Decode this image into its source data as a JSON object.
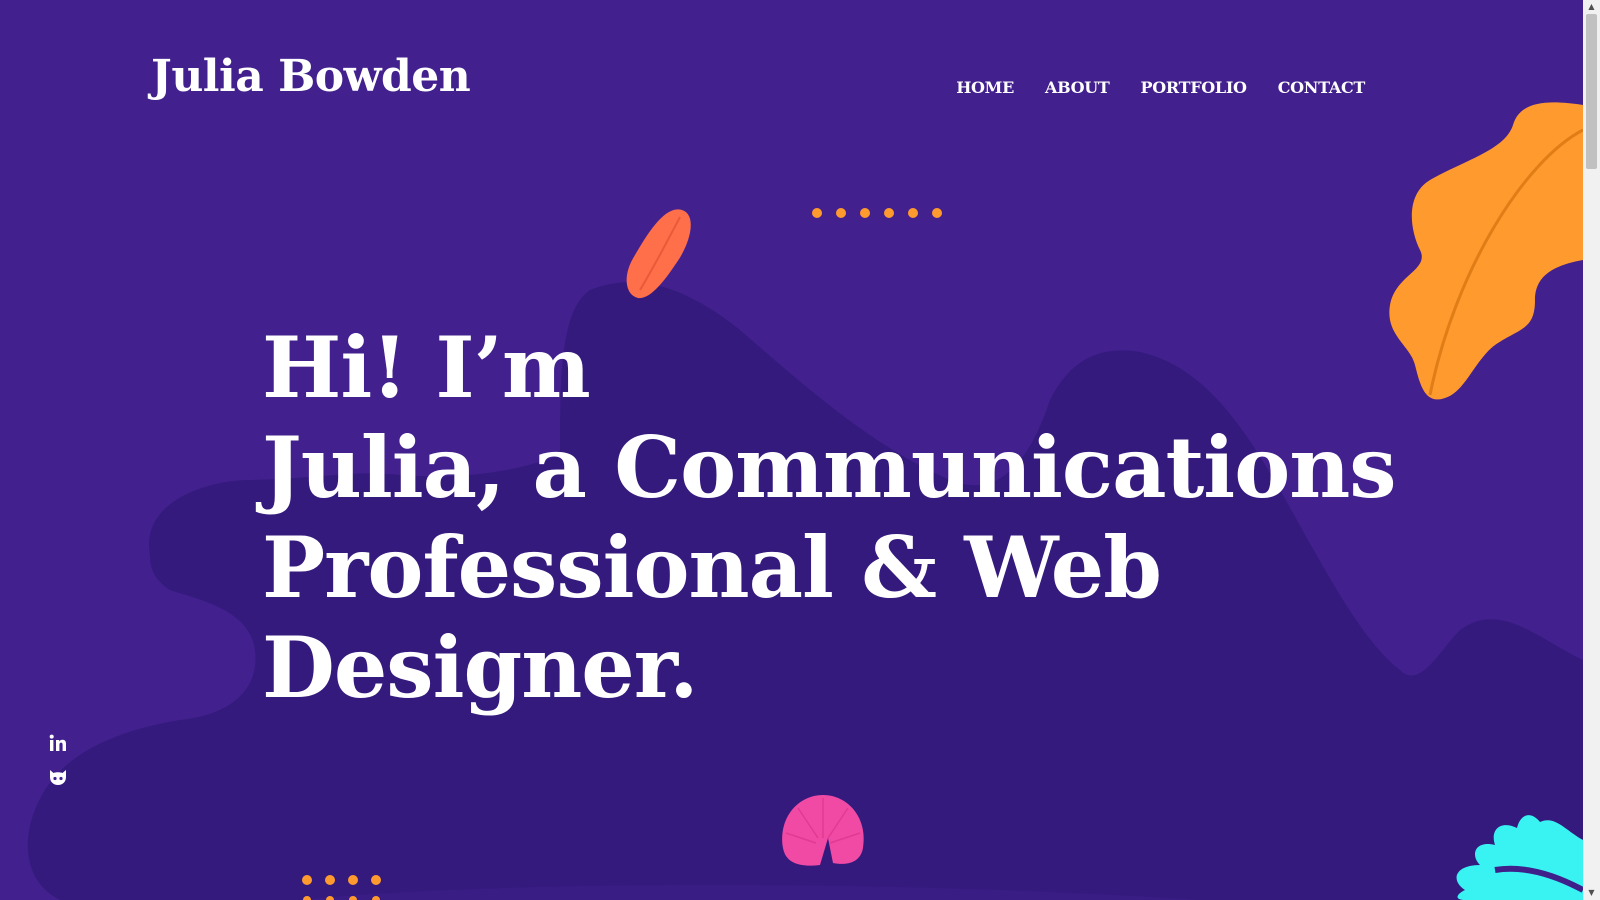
{
  "site": {
    "brand": "Julia Bowden"
  },
  "nav": {
    "items": [
      {
        "label": "HOME"
      },
      {
        "label": "ABOUT"
      },
      {
        "label": "PORTFOLIO"
      },
      {
        "label": "CONTACT"
      }
    ]
  },
  "hero": {
    "lines": [
      "Hi! I’m",
      "Julia, a Communications",
      "Professional & Web",
      "Designer."
    ]
  },
  "social": {
    "icons": [
      "linkedin-icon",
      "github-icon"
    ]
  },
  "colors": {
    "background": "#42208e",
    "background_shape": "#341a7d",
    "accent_orange": "#ff9a2e",
    "accent_coral": "#ff6f4a",
    "accent_pink": "#f04aa4",
    "accent_cyan": "#39f3f2",
    "text": "#ffffff"
  }
}
